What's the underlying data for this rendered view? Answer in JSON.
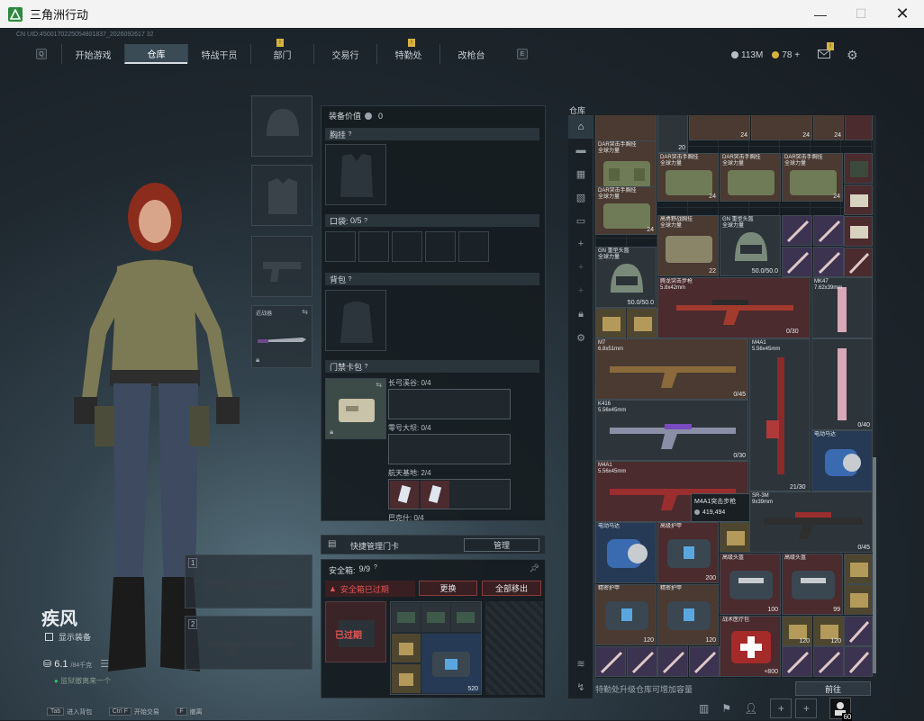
{
  "window": {
    "title": "三角洲行动"
  },
  "uid": "CN UID:4500170225054801837_2026092617 32",
  "nav": {
    "left_key": "Q",
    "right_key": "E",
    "tabs": [
      {
        "label": "开始游戏",
        "active": false,
        "badge": ""
      },
      {
        "label": "仓库",
        "active": true,
        "badge": ""
      },
      {
        "label": "特战干员",
        "active": false,
        "badge": ""
      },
      {
        "label": "部门",
        "active": false,
        "badge": "!"
      },
      {
        "label": "交易行",
        "active": false,
        "badge": ""
      },
      {
        "label": "特勤处",
        "active": false,
        "badge": "!"
      },
      {
        "label": "改枪台",
        "active": false,
        "badge": ""
      }
    ]
  },
  "currency": {
    "hafcoin": "113M",
    "points": "78",
    "plus": "+",
    "mail_badge": "!"
  },
  "character": {
    "name": "疾风",
    "show_equip_label": "显示装备",
    "weight": "6.1",
    "weight_max": "/84千克",
    "status_text": "监狱撤离来一个",
    "knife_label": "近战器",
    "slot1": "1",
    "slot2": "2"
  },
  "equip": {
    "value_label": "装备价值",
    "value": "0",
    "chest_label": "胸挂",
    "pocket_label": "口袋:",
    "pocket_count": "0/5",
    "backpack_label": "背包",
    "keycard_label": "门禁卡包",
    "key_zones": [
      {
        "label": "长弓溪谷: 0/4"
      },
      {
        "label": "零号大坝: 0/4"
      },
      {
        "label": "航天基地: 2/4"
      },
      {
        "label": "巴克什: 0/4"
      }
    ],
    "quick_manage_label": "快捷管理门卡",
    "manage_button": "管理"
  },
  "safebox": {
    "label": "安全箱:",
    "count": "9/9",
    "warning": "安全箱已过期",
    "replace_button": "更换",
    "move_all_button": "全部移出",
    "expired_overlay": "已过期",
    "item_qty": "520"
  },
  "inventory": {
    "title": "仓库",
    "tooltip_name": "M4A1突击步枪",
    "tooltip_price": "419,494",
    "footer_text": "特勤处升级仓库可增加容量",
    "go_button": "前往",
    "items": {
      "bag1_name": "DAR突击手胸挂\n全球力量",
      "bag_name": "DAR突击手胸挂\n全球力量",
      "bag_qty": "24",
      "top_qty": "20",
      "hi_bag_name": "高勇野战胸挂\n全球力量",
      "helmet_name": "GN 重型头盔\n全球力量",
      "helmet_qty": "50.0/50.0",
      "helmet2_qty": "50.0/50.0",
      "qty22": "22",
      "qty24b": "24",
      "rifle1_name": "腾龙突击步枪\n5.8x42mm",
      "rifle1_qty": "",
      "mk47_name": "MK47\n7.62x39mm",
      "mk47_qty": "0/30",
      "m7_name": "M7\n6.8x51mm",
      "m7_qty": "0/45",
      "m4a1_name": "M4A1\n5.56x45mm",
      "k416_name": "K416\n5.56x45mm",
      "k416_qty": "0/30",
      "m4a1b_name": "M4A1\n5.56x45mm",
      "m4a1b_qty": "21/30",
      "qty40": "0/40",
      "motor_name": "电动马达",
      "sr3m_name": "SR-3M\n9x39mm",
      "sr3m_qty": "0/45",
      "motor2_name": "电动马达",
      "armor_name": "高级护甲",
      "armor_qty": "200",
      "armor2_name": "高级头盔",
      "armor2_qty": "100",
      "armor3_name": "高级头盔",
      "armor3_qty": "99",
      "vest_name": "精密护甲",
      "vest_qty": "120",
      "vest2_name": "精密护甲",
      "vest2_qty": "120",
      "medkit_name": "战术医疗包",
      "medkit_qty": "+800",
      "qty120b": "120",
      "qty120c": "120",
      "ammo_qty": "60",
      "ammo_qty2": "60"
    }
  },
  "bottom": {
    "tab_label": "进入背包",
    "tab_key": "Tab",
    "ctrl_label": "开始交易",
    "ctrl_key": "Ctrl F",
    "f_label": "撤离",
    "f_key": "F",
    "avatar_level": "60"
  },
  "colors": {
    "accent_green": "#2dbd6e",
    "warning_red": "#d33a3a",
    "tab_active": "#3a4b56",
    "badge_gold": "#d8b240"
  }
}
